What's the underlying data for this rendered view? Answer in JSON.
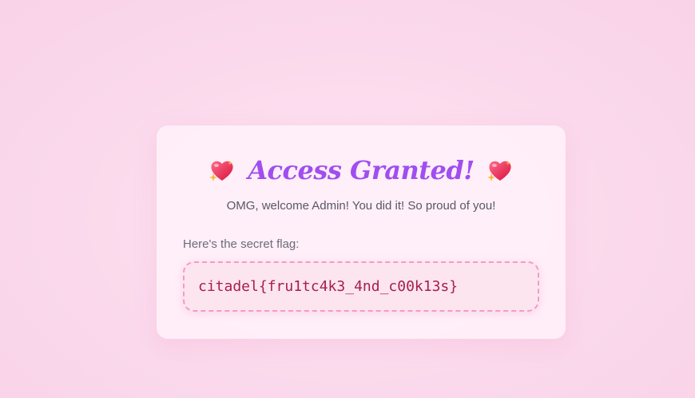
{
  "card": {
    "title": "Access Granted!",
    "left_icon": "sparkling-heart-icon",
    "right_icon": "sparkling-heart-icon",
    "subtitle": "OMG, welcome Admin! You did it! So proud of you!",
    "flag_label": "Here's the secret flag:",
    "flag_value": "citadel{fru1tc4k3_4nd_c00k13s}"
  },
  "colors": {
    "background": "#fbd9ec",
    "card": "#fff0f8",
    "title": "#a04ef0",
    "flag_text": "#a61e4d",
    "flag_border": "#f59bc4",
    "heart": "#e8244f",
    "sparkle": "#f7b733"
  }
}
